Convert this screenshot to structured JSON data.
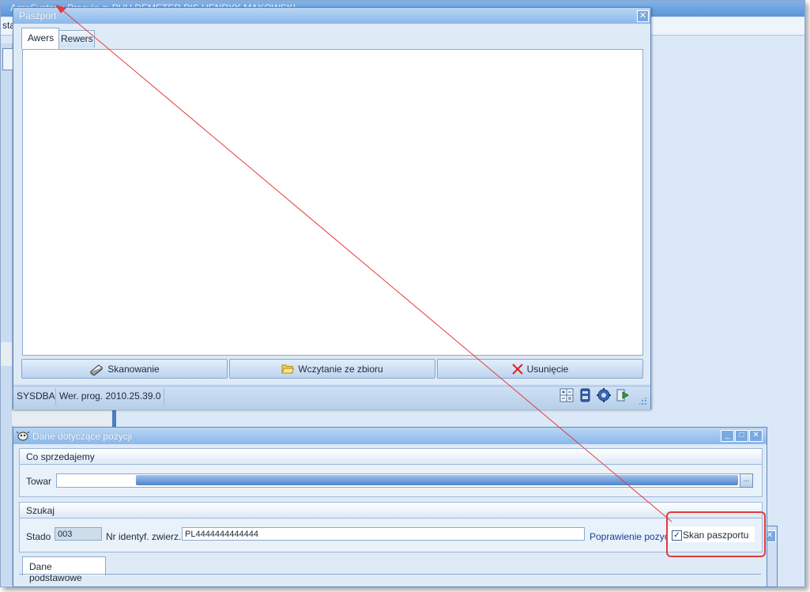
{
  "background_app": {
    "title": "AgroSystem: Pracuje z: PHU DEMETER  PIS HENRYK MAKOWSKI",
    "strip_text": "sta"
  },
  "paszport": {
    "title": "Paszport",
    "close_glyph": "✕",
    "tabs": [
      "Awers",
      "Rewers"
    ],
    "active_tab": "Awers",
    "buttons": {
      "scan": "Skanowanie",
      "load": "Wczytanie ze zbioru",
      "delete": "Usunięcie"
    },
    "status": {
      "user": "SYSDBA",
      "version": "Wer. prog. 2010.25.39.0"
    }
  },
  "dane": {
    "title": "Dane dotyczące pozycji",
    "window_buttons": {
      "minimize": "_",
      "maximize": "□",
      "close": "✕"
    },
    "group_co": {
      "title": "Co sprzedajemy",
      "towar_label": "Towar",
      "ellipsis": "..."
    },
    "group_szukaj": {
      "title": "Szukaj",
      "stado_label": "Stado",
      "stado_value": "003",
      "nr_label": "Nr identyf. zwierz.",
      "nr_value": "PL4444444444444",
      "poprawienie_link": "Poprawienie pozycji",
      "skan_label": "Skan paszportu",
      "skan_checked": true,
      "check_glyph": "✓"
    },
    "tabs": [
      "Dane podstawowe"
    ]
  },
  "behind_window": {
    "close_glyph": "✕"
  },
  "colors": {
    "annotation": "#e23b3b",
    "titlebar": "#8ab8ea",
    "accent": "#4f86cc"
  }
}
